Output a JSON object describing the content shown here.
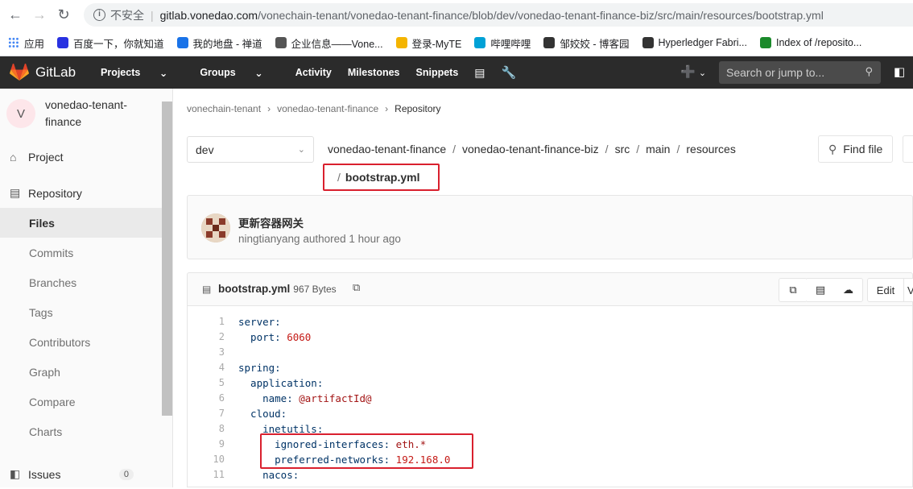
{
  "browser": {
    "security_label": "不安全",
    "url_host": "gitlab.vonedao.com",
    "url_path": "/vonechain-tenant/vonedao-tenant-finance/blob/dev/vonedao-tenant-finance-biz/src/main/resources/bootstrap.yml",
    "bookmarks": [
      {
        "label": "应用",
        "icon": "apps-grid-icon",
        "color": "#4285f4"
      },
      {
        "label": "百度一下，你就知道",
        "icon": "baidu-paw-icon",
        "color": "#2932e1"
      },
      {
        "label": "我的地盘 - 禅道",
        "icon": "zentao-icon",
        "color": "#1a73e8"
      },
      {
        "label": "企业信息——Vone...",
        "icon": "doc-icon",
        "color": "#555555"
      },
      {
        "label": "登录-MyTE",
        "icon": "myte-icon",
        "color": "#f4b400"
      },
      {
        "label": "哔哩哔哩",
        "icon": "bilibili-icon",
        "color": "#00a1d6"
      },
      {
        "label": "邹姣姣 - 博客园",
        "icon": "cnblogs-icon",
        "color": "#333333"
      },
      {
        "label": "Hyperledger Fabri...",
        "icon": "hyperledger-icon",
        "color": "#333333"
      },
      {
        "label": "Index of /reposito...",
        "icon": "nexus-n-icon",
        "color": "#1b8a2b"
      }
    ]
  },
  "gitlab": {
    "brand": "GitLab",
    "nav": [
      "Projects",
      "Groups",
      "Activity",
      "Milestones",
      "Snippets"
    ],
    "search_placeholder": "Search or jump to..."
  },
  "sidebar": {
    "project_initial": "V",
    "project_name_line1": "vonedao-tenant-",
    "project_name_line2": "finance",
    "project_label": "Project",
    "repository_label": "Repository",
    "repo_items": [
      "Files",
      "Commits",
      "Branches",
      "Tags",
      "Contributors",
      "Graph",
      "Compare",
      "Charts"
    ],
    "issues_label": "Issues",
    "issues_count": "0"
  },
  "breadcrumb": [
    "vonechain-tenant",
    "vonedao-tenant-finance",
    "Repository"
  ],
  "branch": "dev",
  "path": [
    "vonedao-tenant-finance",
    "vonedao-tenant-finance-biz",
    "src",
    "main",
    "resources"
  ],
  "file_name": "bootstrap.yml",
  "find_file": "Find file",
  "commit": {
    "title": "更新容器网关",
    "meta": "ningtianyang authored 1 hour ago"
  },
  "file_header": {
    "name": "bootstrap.yml",
    "size": "967 Bytes",
    "edit": "Edit",
    "cut_label": "V"
  },
  "code_lines": [
    {
      "n": "1",
      "key": "server:",
      "val": ""
    },
    {
      "n": "2",
      "key": "  port:",
      "val": " 6060"
    },
    {
      "n": "3",
      "key": "",
      "val": ""
    },
    {
      "n": "4",
      "key": "spring:",
      "val": ""
    },
    {
      "n": "5",
      "key": "  application:",
      "val": ""
    },
    {
      "n": "6",
      "key": "    name:",
      "val": " @artifactId@"
    },
    {
      "n": "7",
      "key": "  cloud:",
      "val": ""
    },
    {
      "n": "8",
      "key": "    inetutils:",
      "val": ""
    },
    {
      "n": "9",
      "key": "      ignored-interfaces:",
      "val": " eth.*"
    },
    {
      "n": "10",
      "key": "      preferred-networks:",
      "val": " 192.168.0"
    },
    {
      "n": "11",
      "key": "    nacos:",
      "val": ""
    }
  ]
}
